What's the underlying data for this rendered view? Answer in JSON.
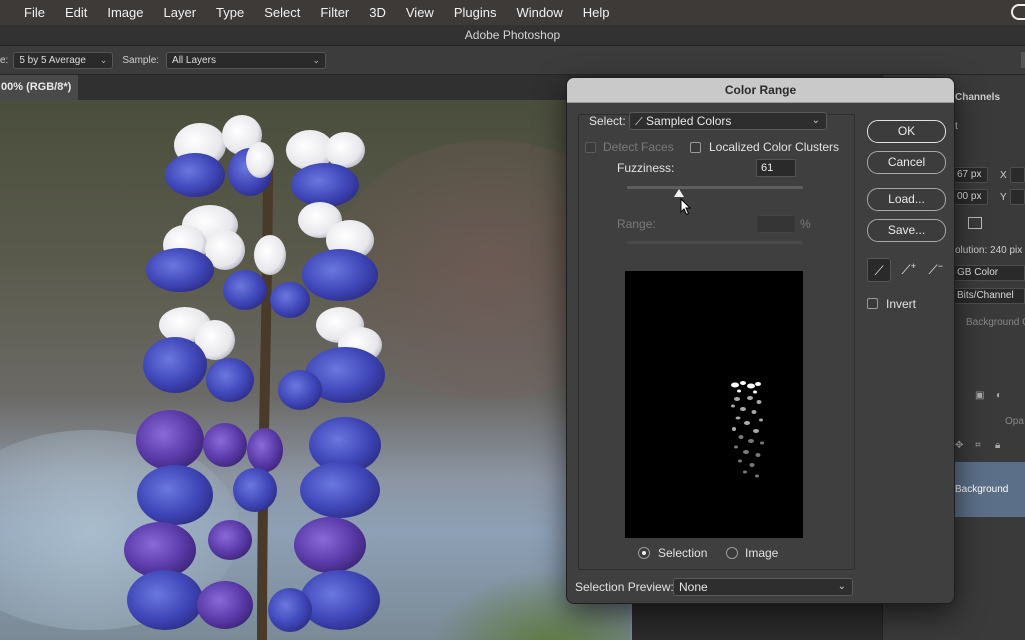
{
  "menubar": {
    "items": [
      "File",
      "Edit",
      "Image",
      "Layer",
      "Type",
      "Select",
      "Filter",
      "3D",
      "View",
      "Plugins",
      "Window",
      "Help"
    ]
  },
  "window": {
    "title": "Adobe Photoshop"
  },
  "options_bar": {
    "sample_size_label": "e:",
    "sample_size_value": "5 by 5 Average",
    "sample_label": "Sample:",
    "sample_value": "All Layers"
  },
  "document": {
    "tab_label": "00% (RGB/8*)"
  },
  "right_panel": {
    "channels_tab": "Channels",
    "tab_t": "t",
    "width_value": "67 px",
    "x_label": "X",
    "height_value": "00 px",
    "y_label": "Y",
    "resolution": "olution: 240 pix",
    "color_mode": "GB Color",
    "bit_depth": "Bits/Channel",
    "background_color_label": "Background C",
    "opacity_label": "Opa",
    "layer_name": "Background"
  },
  "dialog": {
    "title": "Color Range",
    "select_label": "Select:",
    "select_value": "Sampled Colors",
    "detect_faces_label": "Detect Faces",
    "detect_faces_checked": false,
    "localized_label": "Localized Color Clusters",
    "localized_checked": false,
    "fuzziness_label": "Fuzziness:",
    "fuzziness_value": "61",
    "fuzziness_slider_fraction": 0.3,
    "range_label": "Range:",
    "range_value": "",
    "range_unit": "%",
    "selection_radio_label": "Selection",
    "image_radio_label": "Image",
    "selected_view": "Selection",
    "selection_preview_label": "Selection Preview:",
    "selection_preview_value": "None",
    "buttons": {
      "ok": "OK",
      "cancel": "Cancel",
      "load": "Load...",
      "save": "Save..."
    },
    "invert_label": "Invert",
    "invert_checked": false
  }
}
